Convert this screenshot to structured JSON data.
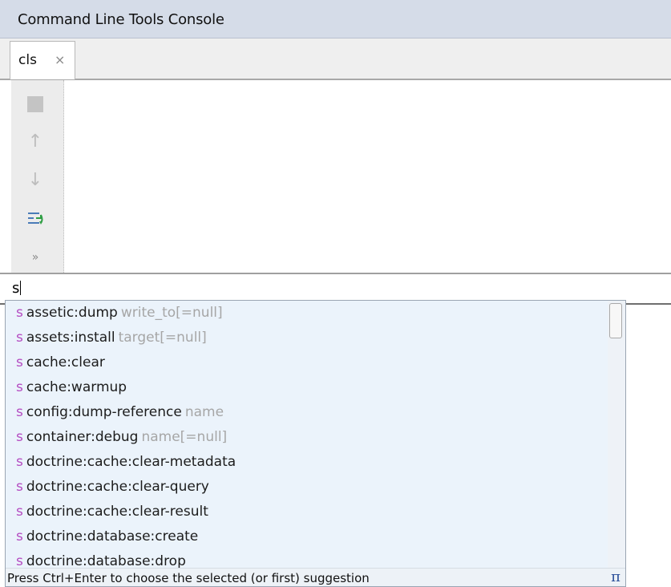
{
  "window": {
    "title": "Command Line Tools Console"
  },
  "tabs": [
    {
      "label": "cls",
      "close_icon": "×"
    }
  ],
  "toolbar": {
    "items": [
      {
        "name": "stop-icon"
      },
      {
        "name": "arrow-up-icon",
        "glyph": "↑"
      },
      {
        "name": "arrow-down-icon",
        "glyph": "↓"
      },
      {
        "name": "soft-wrap-icon"
      },
      {
        "name": "more-icon",
        "glyph": "»"
      }
    ]
  },
  "input": {
    "value": "s"
  },
  "completion": {
    "items": [
      {
        "prefix": "s",
        "command": "assetic:dump",
        "params": "write_to[=null]"
      },
      {
        "prefix": "s",
        "command": "assets:install",
        "params": "target[=null]"
      },
      {
        "prefix": "s",
        "command": "cache:clear",
        "params": ""
      },
      {
        "prefix": "s",
        "command": "cache:warmup",
        "params": ""
      },
      {
        "prefix": "s",
        "command": "config:dump-reference",
        "params": "name"
      },
      {
        "prefix": "s",
        "command": "container:debug",
        "params": "name[=null]"
      },
      {
        "prefix": "s",
        "command": "doctrine:cache:clear-metadata",
        "params": ""
      },
      {
        "prefix": "s",
        "command": "doctrine:cache:clear-query",
        "params": ""
      },
      {
        "prefix": "s",
        "command": "doctrine:cache:clear-result",
        "params": ""
      },
      {
        "prefix": "s",
        "command": "doctrine:database:create",
        "params": ""
      },
      {
        "prefix": "s",
        "command": "doctrine:database:drop",
        "params": ""
      }
    ],
    "hint": "Press Ctrl+Enter to choose the selected (or first) suggestion",
    "pi_glyph": "π"
  },
  "colors": {
    "title_bar": "#d5dce8",
    "popup_background": "#ebf3fb",
    "prefix_accent": "#b44cc2",
    "param_text": "#a6a6a6",
    "pi_icon": "#2a4f9a"
  }
}
